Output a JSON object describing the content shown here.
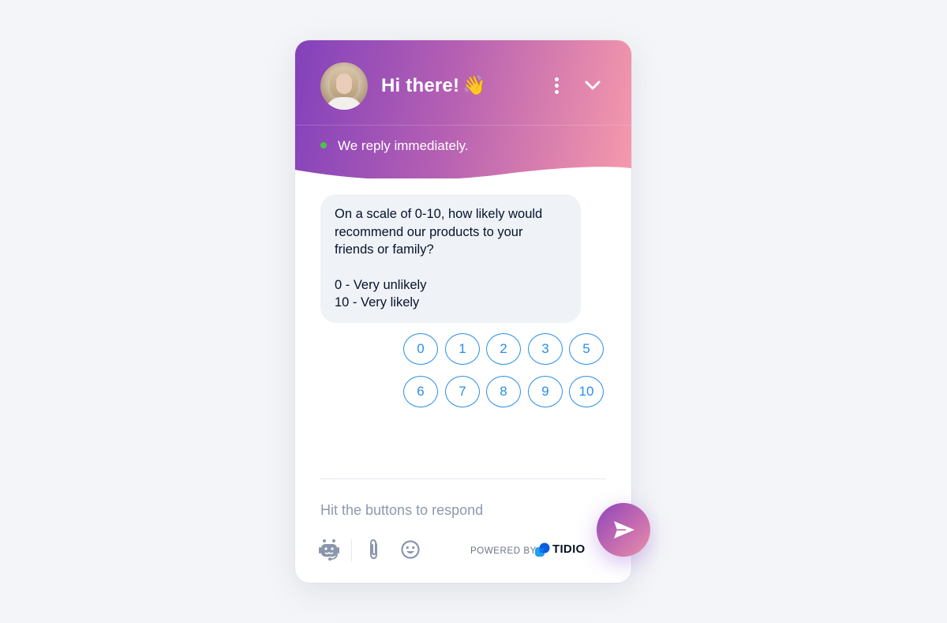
{
  "header": {
    "title": "Hi there!",
    "title_emoji": "👋",
    "status_text": "We reply immediately.",
    "status_color": "#4cc24a",
    "gradient_start": "#8241bb",
    "gradient_end": "#f59aac",
    "menu_icon": "more-vertical-icon",
    "collapse_icon": "chevron-down-icon"
  },
  "message": {
    "lines": [
      "On a scale of 0-10, how likely would",
      "recommend our products to your",
      "friends or family?"
    ],
    "legend": [
      "0 - Very unlikely",
      "10 - Very likely"
    ]
  },
  "options": [
    "0",
    "1",
    "2",
    "3",
    "5",
    "6",
    "7",
    "8",
    "9",
    "10"
  ],
  "accent_color": "#2a8ee8",
  "composer": {
    "placeholder": "Hit the buttons to respond",
    "icons": [
      "bot-icon",
      "paperclip-icon",
      "emoji-icon"
    ],
    "send_icon": "send-icon"
  },
  "branding": {
    "powered_by": "POWERED BY",
    "brand": "TIDIO"
  }
}
